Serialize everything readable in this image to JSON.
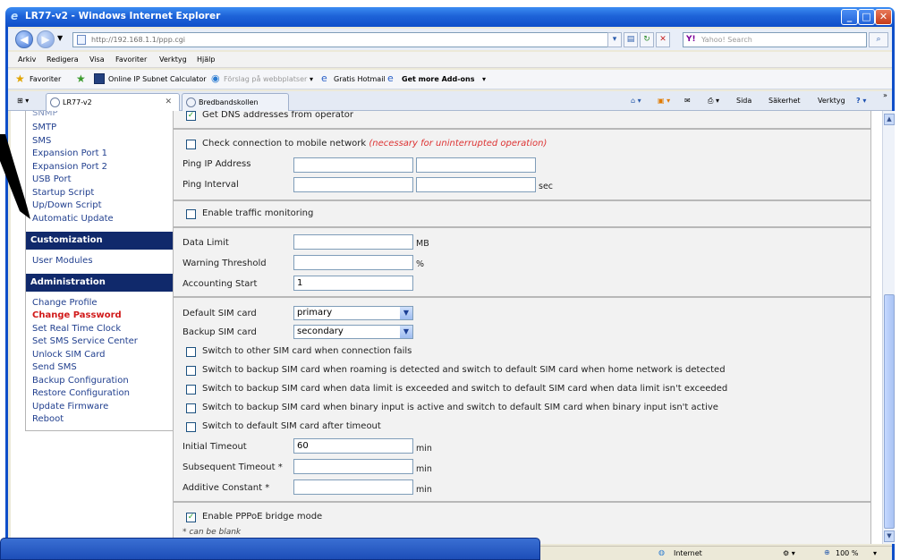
{
  "window": {
    "title": "LR77-v2 - Windows Internet Explorer"
  },
  "address_bar": {
    "url": "http://192.168.1.1/ppp.cgi",
    "search_placeholder": "Yahoo! Search"
  },
  "menu": [
    "Arkiv",
    "Redigera",
    "Visa",
    "Favoriter",
    "Verktyg",
    "Hjälp"
  ],
  "favorites_bar": {
    "favorites": "Favoriter",
    "items": [
      "Online IP Subnet Calculator",
      "Förslag på webbplatser",
      "Gratis Hotmail",
      "Get more Add-ons"
    ]
  },
  "tabs": [
    {
      "label": "LR77-v2",
      "active": true
    },
    {
      "label": "Bredbandskollen",
      "active": false
    }
  ],
  "command_bar": [
    "Sida",
    "Säkerhet",
    "Verktyg"
  ],
  "sidebar": {
    "top_links": [
      "SNMP",
      "SMTP",
      "SMS",
      "Expansion Port 1",
      "Expansion Port 2",
      "USB Port",
      "Startup Script",
      "Up/Down Script",
      "Automatic Update"
    ],
    "customization": {
      "title": "Customization",
      "links": [
        "User Modules"
      ]
    },
    "administration": {
      "title": "Administration",
      "links": [
        "Change Profile",
        "Change Password",
        "Set Real Time Clock",
        "Set SMS Service Center",
        "Unlock SIM Card",
        "Send SMS",
        "Backup Configuration",
        "Restore Configuration",
        "Update Firmware",
        "Reboot"
      ]
    }
  },
  "form": {
    "get_dns": {
      "label": "Get DNS addresses from operator",
      "checked": true
    },
    "check_connection": {
      "label": "Check connection to mobile network",
      "note": "(necessary for uninterrupted operation)",
      "checked": false
    },
    "ping_ip": {
      "label": "Ping IP Address",
      "value1": "",
      "value2": ""
    },
    "ping_interval": {
      "label": "Ping Interval",
      "value1": "",
      "value2": "",
      "unit": "sec"
    },
    "traffic": {
      "label": "Enable traffic monitoring",
      "checked": false
    },
    "data_limit": {
      "label": "Data Limit",
      "value": "",
      "unit": "MB"
    },
    "warning_threshold": {
      "label": "Warning Threshold",
      "value": "",
      "unit": "%"
    },
    "accounting_start": {
      "label": "Accounting Start",
      "value": "1"
    },
    "default_sim": {
      "label": "Default SIM card",
      "value": "primary"
    },
    "backup_sim": {
      "label": "Backup SIM card",
      "value": "secondary"
    },
    "switch_options": [
      "Switch to other SIM card when connection fails",
      "Switch to backup SIM card when roaming is detected and switch to default SIM card when home network is detected",
      "Switch to backup SIM card when data limit is exceeded and switch to default SIM card when data limit isn't exceeded",
      "Switch to backup SIM card when binary input is active and switch to default SIM card when binary input isn't active",
      "Switch to default SIM card after timeout"
    ],
    "initial_timeout": {
      "label": "Initial Timeout",
      "value": "60",
      "unit": "min"
    },
    "subsequent_timeout": {
      "label": "Subsequent Timeout *",
      "value": "",
      "unit": "min"
    },
    "additive_constant": {
      "label": "Additive Constant *",
      "value": "",
      "unit": "min"
    },
    "pppoe_bridge": {
      "label": "Enable PPPoE bridge mode",
      "checked": true
    },
    "footnote": "* can be blank"
  },
  "status_bar": {
    "zone": "Internet",
    "zoom": "100 %"
  }
}
